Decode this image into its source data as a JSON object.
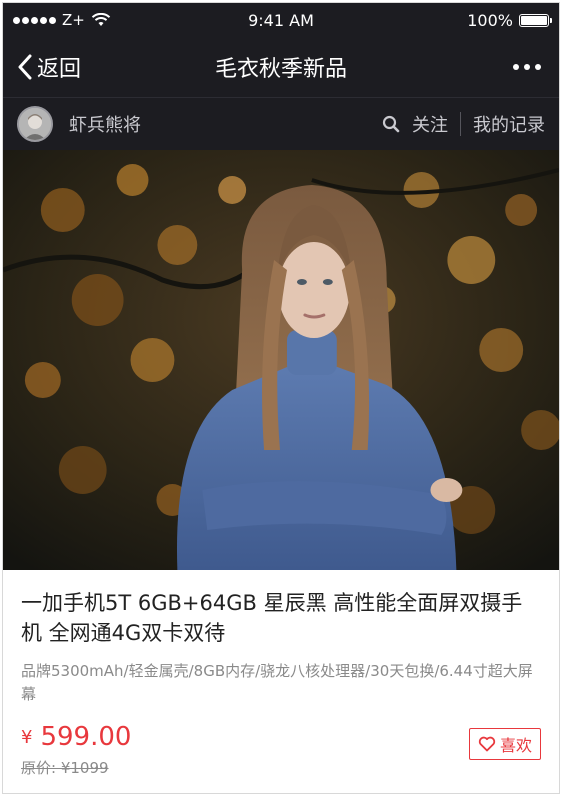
{
  "status_bar": {
    "carrier": "Z+",
    "time": "9:41 AM",
    "battery": "100%",
    "battery_level": 1.0
  },
  "nav": {
    "back_label": "返回",
    "title": "毛衣秋季新品"
  },
  "user": {
    "name": "虾兵熊将",
    "follow_label": "关注",
    "records_label": "我的记录"
  },
  "product": {
    "title": "一加手机5T 6GB+64GB 星辰黑 高性能全面屏双摄手机 全网通4G双卡双待",
    "description": "品牌5300mAh/轻金属壳/8GB内存/骁龙八核处理器/30天包换/6.44寸超大屏幕",
    "currency": "¥",
    "price": "599.00",
    "original_price": "原价: ¥1099",
    "like_label": "喜欢"
  },
  "colors": {
    "header_bg": "#1c1c21",
    "accent": "#e8383d"
  },
  "icons": [
    "signal-dots-icon",
    "wifi-icon",
    "battery-icon",
    "chevron-left-icon",
    "more-icon",
    "search-icon",
    "heart-icon"
  ]
}
